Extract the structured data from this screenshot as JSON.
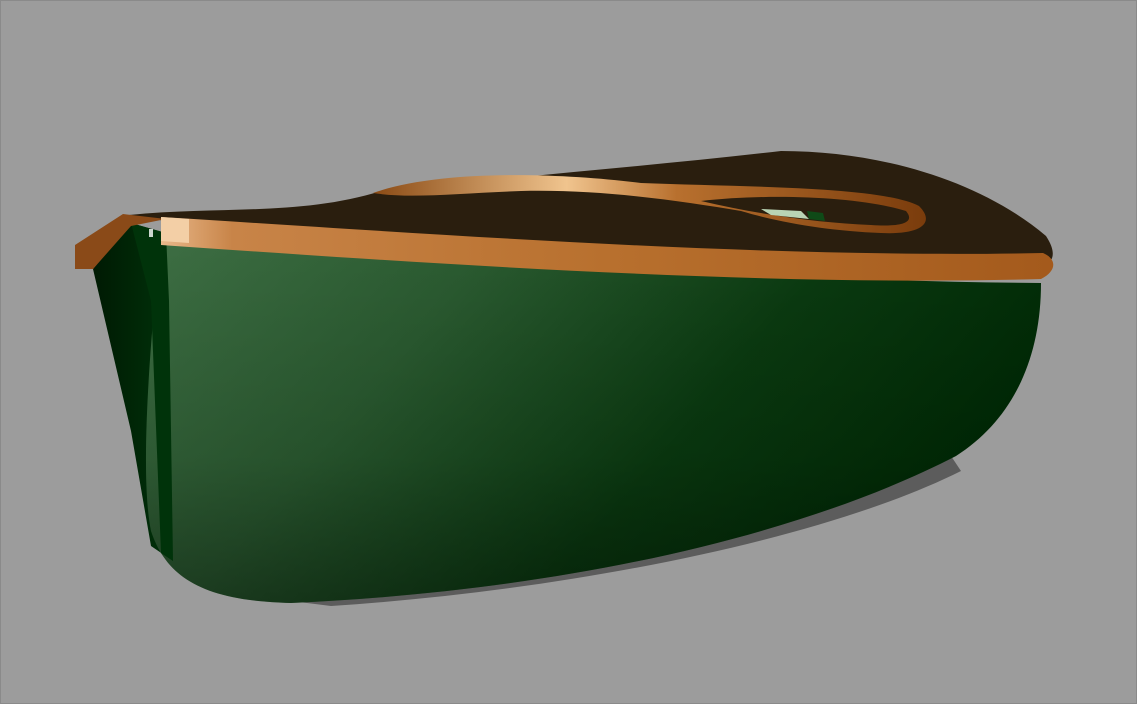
{
  "scene": {
    "background_color": "#9c9c9c",
    "object": "boat-hull",
    "colors": {
      "hull_dark": "#002a05",
      "hull_mid": "#0f4a17",
      "hull_light": "#3d6e42",
      "deck": "#2a1e0e",
      "rail": "#b06a2c",
      "rail_highlight": "#f3cfa6",
      "shadow": "#555555"
    }
  }
}
